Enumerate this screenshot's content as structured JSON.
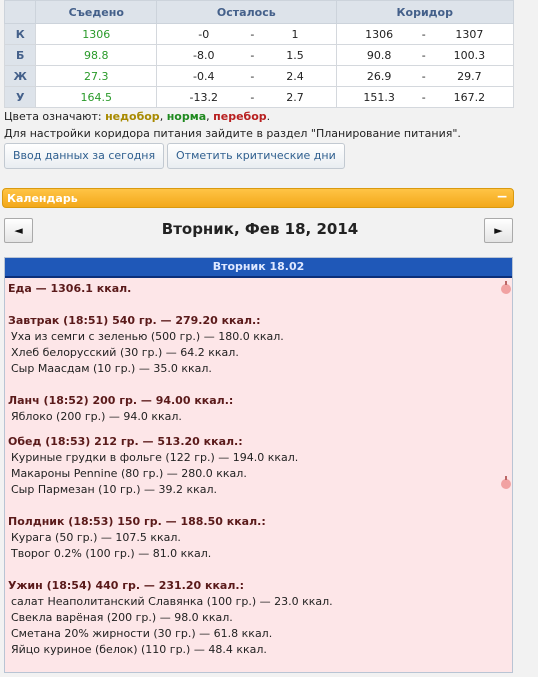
{
  "summary": {
    "headers": {
      "corner": "",
      "eaten": "Съедено",
      "remaining": "Осталось",
      "corridor": "Коридор"
    },
    "rows": [
      {
        "label": "К",
        "eaten": "1306",
        "rem_a": "-0",
        "dash1": "-",
        "rem_b": "1",
        "cor_a": "1306",
        "dash2": "-",
        "cor_b": "1307"
      },
      {
        "label": "Б",
        "eaten": "98.8",
        "rem_a": "-8.0",
        "dash1": "-",
        "rem_b": "1.5",
        "cor_a": "90.8",
        "dash2": "-",
        "cor_b": "100.3"
      },
      {
        "label": "Ж",
        "eaten": "27.3",
        "rem_a": "-0.4",
        "dash1": "-",
        "rem_b": "2.4",
        "cor_a": "26.9",
        "dash2": "-",
        "cor_b": "29.7"
      },
      {
        "label": "У",
        "eaten": "164.5",
        "rem_a": "-13.2",
        "dash1": "-",
        "rem_b": "2.7",
        "cor_a": "151.3",
        "dash2": "-",
        "cor_b": "167.2"
      }
    ]
  },
  "legend": {
    "prefix": "Цвета означают: ",
    "under": "недобор",
    "sep1": ", ",
    "norm": "норма",
    "sep2": ", ",
    "over": "перебор",
    "end": "."
  },
  "info": "Для настройки коридора питания зайдите в раздел \"Планирование питания\".",
  "buttons": {
    "enter_today": "Ввод данных за сегодня",
    "mark_critical": "Отметить критические дни"
  },
  "calendar": {
    "title": "Календарь",
    "collapse": "−",
    "prev": "◄",
    "next": "►",
    "date": "Вторник, Фев 18, 2014",
    "day_header": "Вторник 18.02",
    "lines": {
      "food_total": "Еда — 1306.1 ккал.",
      "breakfast": "Завтрак (18:51) 540 гр. — 279.20 ккал.:",
      "b1": "Уха из семги с зеленью (500 гр.) — 180.0 ккал.",
      "b2": "Хлеб белорусский (30 гр.) — 64.2 ккал.",
      "b3": "Сыр Маасдам (10 гр.) — 35.0 ккал.",
      "lunch": "Ланч (18:52) 200 гр. — 94.00 ккал.:",
      "l1": "Яблоко (200 гр.) — 94.0 ккал.",
      "dinner": "Обед (18:53) 212 гр. — 513.20 ккал.:",
      "d1": "Куриные грудки в фольге (122 гр.) — 194.0 ккал.",
      "d2": "Макароны Pennine (80 гр.) — 280.0 ккал.",
      "d3": "Сыр Пармезан (10 гр.) — 39.2 ккал.",
      "snack": "Полдник (18:53) 150 гр. — 188.50 ккал.:",
      "s1": "Курага (50 гр.) — 107.5 ккал.",
      "s2": "Творог 0.2% (100 гр.) — 81.0 ккал.",
      "supper": "Ужин (18:54) 440 гр. — 231.20 ккал.:",
      "u1": "салат Неаполитанский Славянка (100 гр.) — 23.0 ккал.",
      "u2": "Свекла варёная (200 гр.) — 98.0 ккал.",
      "u3": "Сметана 20% жирности (30 гр.) — 61.8 ккал.",
      "u4": "Яйцо куриное (белок) (110 гр.) — 48.4 ккал."
    }
  },
  "colors": {
    "under": "#a88a00",
    "norm": "#1f8a1f",
    "over": "#b82020",
    "calendar_bar": "#f3a81a",
    "day_header": "#1f58b8"
  }
}
